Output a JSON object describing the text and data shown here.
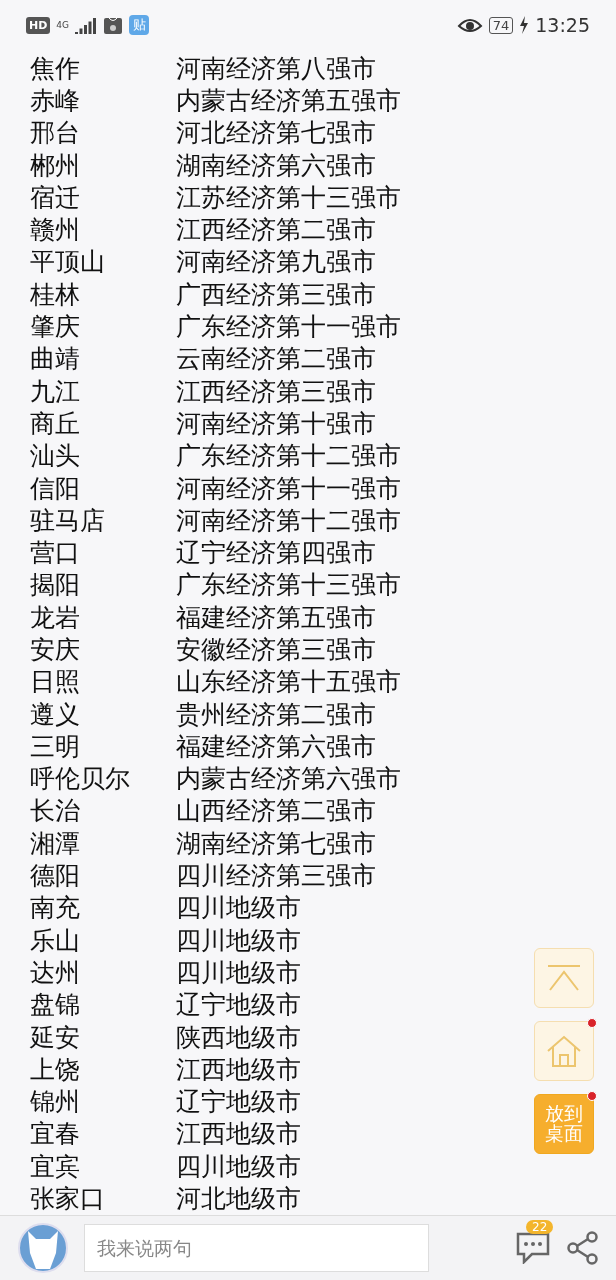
{
  "status_bar": {
    "hd": "HD",
    "network": "4G",
    "app_badge": "贴",
    "battery": "74",
    "time": "13:25"
  },
  "rows": [
    {
      "city": "焦作",
      "note": "河南经济第八强市"
    },
    {
      "city": "赤峰",
      "note": "内蒙古经济第五强市"
    },
    {
      "city": "邢台",
      "note": "河北经济第七强市"
    },
    {
      "city": "郴州",
      "note": "湖南经济第六强市"
    },
    {
      "city": "宿迁",
      "note": "江苏经济第十三强市"
    },
    {
      "city": "赣州",
      "note": "江西经济第二强市"
    },
    {
      "city": "平顶山",
      "note": "河南经济第九强市"
    },
    {
      "city": "桂林",
      "note": "广西经济第三强市"
    },
    {
      "city": "肇庆",
      "note": "广东经济第十一强市"
    },
    {
      "city": "曲靖",
      "note": "云南经济第二强市"
    },
    {
      "city": "九江",
      "note": "江西经济第三强市"
    },
    {
      "city": "商丘",
      "note": "河南经济第十强市"
    },
    {
      "city": "汕头",
      "note": "广东经济第十二强市"
    },
    {
      "city": "信阳",
      "note": "河南经济第十一强市"
    },
    {
      "city": "驻马店",
      "note": "河南经济第十二强市"
    },
    {
      "city": "营口",
      "note": "辽宁经济第四强市"
    },
    {
      "city": "揭阳",
      "note": "广东经济第十三强市"
    },
    {
      "city": "龙岩",
      "note": "福建经济第五强市"
    },
    {
      "city": "安庆",
      "note": "安徽经济第三强市"
    },
    {
      "city": "日照",
      "note": "山东经济第十五强市"
    },
    {
      "city": "遵义",
      "note": "贵州经济第二强市"
    },
    {
      "city": "三明",
      "note": "福建经济第六强市"
    },
    {
      "city": "呼伦贝尔",
      "note": "内蒙古经济第六强市"
    },
    {
      "city": "长治",
      "note": "山西经济第二强市"
    },
    {
      "city": "湘潭",
      "note": "湖南经济第七强市"
    },
    {
      "city": "德阳",
      "note": "四川经济第三强市"
    },
    {
      "city": "南充",
      "note": "四川地级市"
    },
    {
      "city": "乐山",
      "note": "四川地级市"
    },
    {
      "city": "达州",
      "note": "四川地级市"
    },
    {
      "city": "盘锦",
      "note": "辽宁地级市"
    },
    {
      "city": "延安",
      "note": "陕西地级市"
    },
    {
      "city": "上饶",
      "note": "江西地级市"
    },
    {
      "city": "锦州",
      "note": "辽宁地级市"
    },
    {
      "city": "宜春",
      "note": "江西地级市"
    },
    {
      "city": "宜宾",
      "note": "四川地级市"
    },
    {
      "city": "张家口",
      "note": "河北地级市"
    }
  ],
  "float_buttons": [
    {
      "kind": "top",
      "dot": false
    },
    {
      "kind": "home",
      "dot": true
    },
    {
      "kind": "desktop",
      "label": "放到桌面",
      "dot": true
    }
  ],
  "bottom_bar": {
    "comment": {
      "placeholder": "我来说两句"
    },
    "comment_count": "22"
  }
}
